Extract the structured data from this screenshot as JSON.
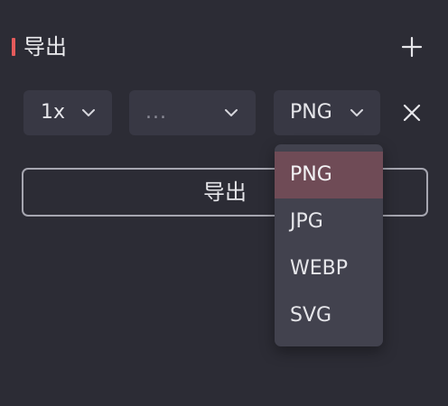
{
  "header": {
    "title": "导出",
    "accent_color": "#e55b5b",
    "add_icon": "plus-icon"
  },
  "export_row": {
    "scale": {
      "value": "1x",
      "icon": "chevron-down-icon"
    },
    "suffix": {
      "value": "...",
      "icon": "chevron-down-icon"
    },
    "format": {
      "value": "PNG",
      "icon": "chevron-down-icon"
    },
    "remove_icon": "close-icon"
  },
  "export_button": {
    "label": "导出"
  },
  "format_dropdown": {
    "selected": "PNG",
    "selected_color": "#6f4b56",
    "options": [
      {
        "label": "PNG"
      },
      {
        "label": "JPG"
      },
      {
        "label": "WEBP"
      },
      {
        "label": "SVG"
      }
    ]
  },
  "colors": {
    "background": "#2c2c35",
    "control": "#383844",
    "menu": "#42424e"
  }
}
